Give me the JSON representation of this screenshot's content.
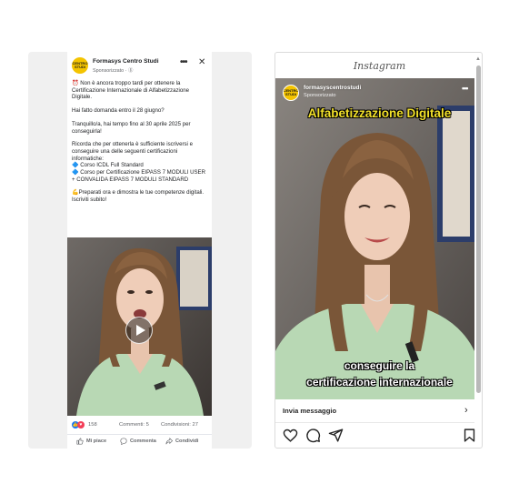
{
  "facebook": {
    "page_name": "Formasys Centro Studi",
    "sponsored": "Sponsorizzato · ⓖ",
    "logo_text": "CENTRO STUDI",
    "post": {
      "line1": "⏰ Non è ancora troppo tardi per ottenere la Certificazione Internazionale di Alfabetizzazione Digitale.",
      "line2": "Hai fatto domanda entro il 28 giugno?",
      "line3": "Tranquillo/a, hai tempo fino al 30 aprile 2025 per conseguirla!",
      "line4": "Ricorda che per ottenerla è sufficiente iscriversi e conseguire una delle seguenti certificazioni informatiche:",
      "bullet1": "🔷 Corso ICDL Full Standard",
      "bullet2": "🔷 Corso per Certificazione EIPASS 7 MODULI USER + CONVALIDA EIPASS 7 MODULI STANDARD",
      "line5": "💪Preparati ora e dimostra le tue competenze digitali. Iscriviti subito!"
    },
    "reactions_count": "158",
    "comments": "Commenti: 5",
    "shares": "Condivisioni: 27",
    "actions": {
      "like": "Mi piace",
      "comment": "Commenta",
      "share": "Condividi"
    }
  },
  "instagram": {
    "brand": "Instagram",
    "username": "formasyscentrostudi",
    "sponsored": "Sponsorizzato",
    "logo_text": "CENTRO STUDI",
    "video_title": "Alfabetizzazione Digitale",
    "caption_line1": "conseguire la",
    "caption_line2": "certificazione internazionale",
    "cta_label": "Invia messaggio"
  },
  "icons": {
    "fb_more": "more-horizontal-icon",
    "fb_close": "close-icon",
    "fb_play": "play-icon",
    "ig_heart": "heart-icon",
    "ig_comment": "comment-icon",
    "ig_share": "send-icon",
    "ig_save": "bookmark-icon"
  },
  "colors": {
    "brand_yellow": "#f4c400",
    "fb_blue": "#1877f2",
    "ig_title_yellow": "#f2e12a",
    "shirt_green": "#b8d8b4"
  }
}
